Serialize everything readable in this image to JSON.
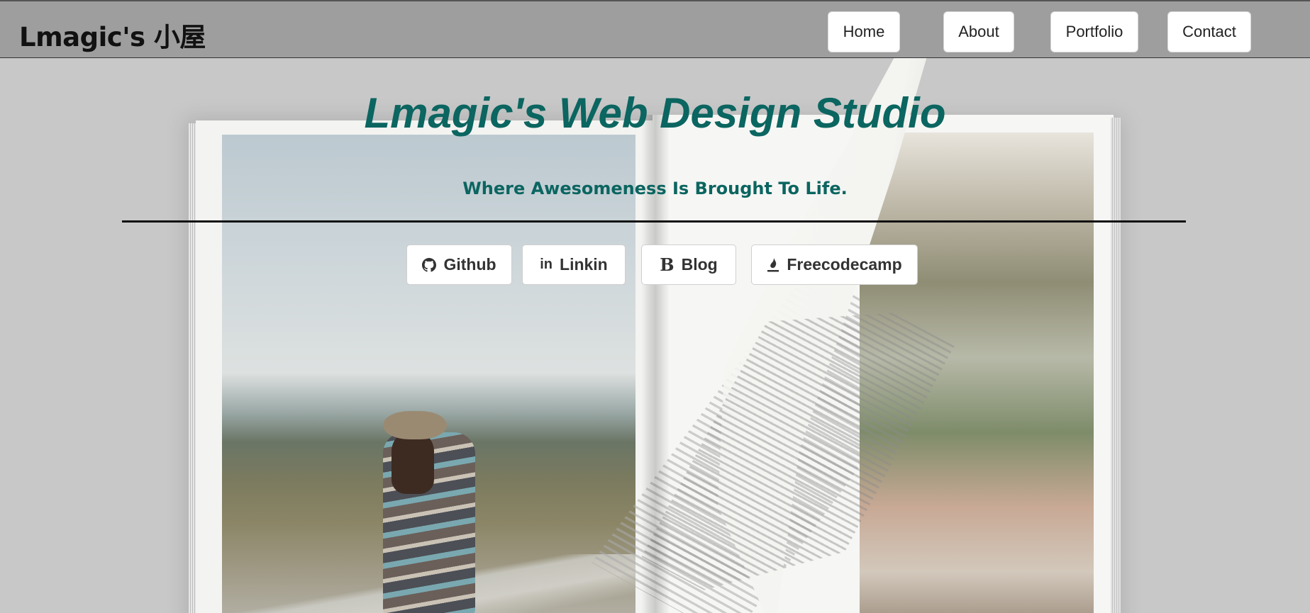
{
  "navbar": {
    "brand": "Lmagic's 小屋",
    "links": [
      "Home",
      "About",
      "Portfolio",
      "Contact"
    ]
  },
  "hero": {
    "title": "Lmagic's Web Design Studio",
    "subtitle": "Where Awesomeness Is Brought To Life."
  },
  "social": {
    "github": "Github",
    "linkedin": "Linkin",
    "blog": "Blog",
    "freecodecamp": "Freecodecamp",
    "icons": [
      "github-icon",
      "linkedin-icon",
      "blog-icon",
      "freecodecamp-icon"
    ]
  },
  "colors": {
    "accent": "#0b6560",
    "navbar_bg": "#9e9e9e",
    "page_bg": "#c8c8c8"
  }
}
